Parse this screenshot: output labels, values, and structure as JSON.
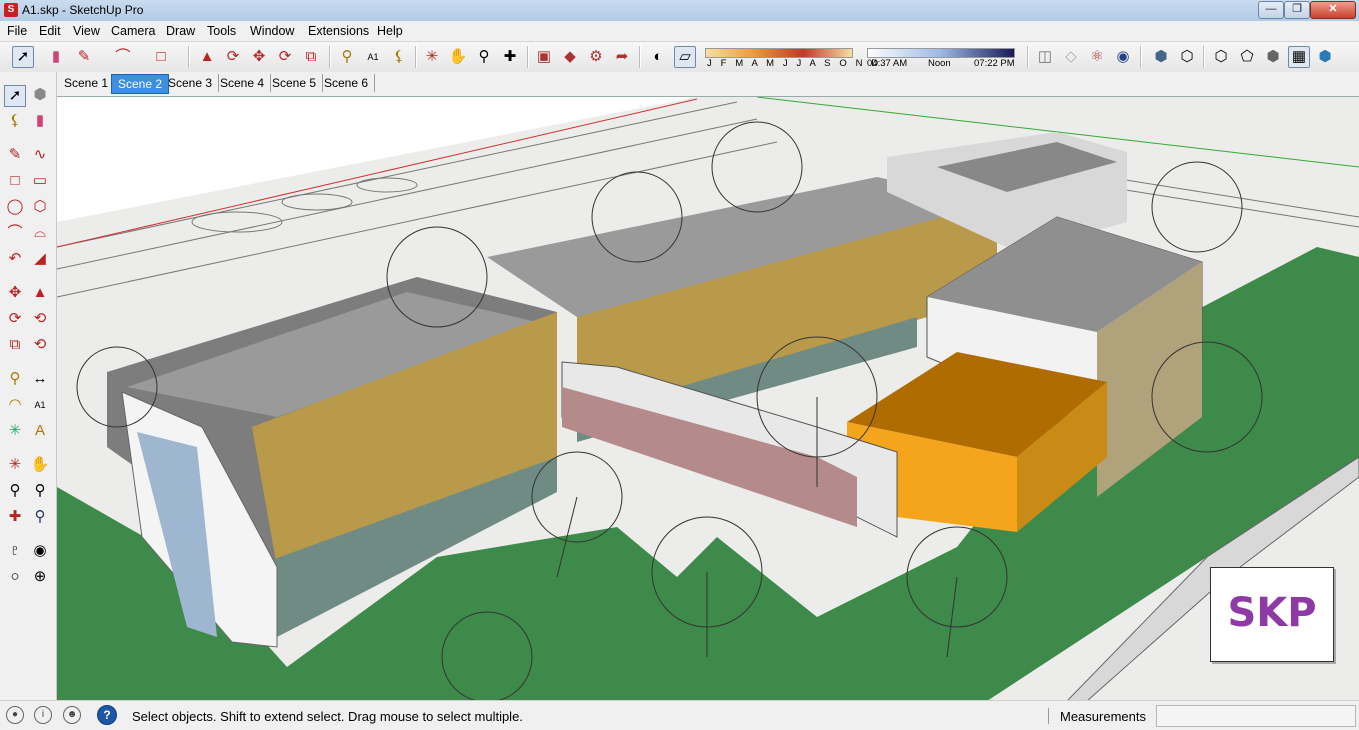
{
  "window": {
    "title": "A1.skp - SketchUp Pro",
    "app_icon": "sketchup-icon",
    "controls": [
      "minimize-icon",
      "maximize-icon",
      "close-icon"
    ]
  },
  "menu": [
    "File",
    "Edit",
    "View",
    "Camera",
    "Draw",
    "Tools",
    "Window",
    "Extensions",
    "Help"
  ],
  "toolbar": {
    "tools": [
      "select-icon",
      "eraser-icon",
      "pencil-icon",
      "arc-icon",
      "rectangle-icon",
      "push-pull-icon",
      "follow-me-icon",
      "move-icon",
      "rotate-icon",
      "scale-icon",
      "tape-measure-icon",
      "text-icon",
      "paint-bucket-icon",
      "orbit-icon",
      "pan-icon",
      "zoom-icon",
      "zoom-extents-icon",
      "warehouse-icon",
      "components-icon",
      "extensions-icon",
      "share-icon",
      "shadows-icon",
      "fog-icon"
    ],
    "shadow_months": "J F M A M J J A S O N D",
    "shadow_time_start": "04:37 AM",
    "shadow_time_mid": "Noon",
    "shadow_time_end": "07:22 PM",
    "right_tools": [
      "section-plane-icon",
      "section-display-icon",
      "axes-icon",
      "dimensions-icon",
      "iso-view-icon",
      "top-view-icon",
      "xray-icon",
      "wireframe-icon",
      "hidden-line-icon",
      "shaded-icon",
      "shaded-textures-icon",
      "monochrome-icon"
    ]
  },
  "scenes": {
    "tabs": [
      "Scene 1",
      "Scene 2",
      "Scene 3",
      "Scene 4",
      "Scene 5",
      "Scene 6"
    ],
    "active": "Scene 2"
  },
  "viewport": {
    "description_icon": "3d-model-viewport",
    "logo_text": "SKP",
    "colors": {
      "lawn": "#3e8a4a",
      "facade": "#b99a4a",
      "accent": "#f4a51c",
      "roof": "#8f8f8f",
      "glass": "#b48a8a"
    }
  },
  "status": {
    "icons": [
      "geolocation-icon",
      "credits-icon",
      "user-icon",
      "help-icon"
    ],
    "help_glyph": "?",
    "message": "Select objects. Shift to extend select. Drag mouse to select multiple.",
    "measurements_label": "Measurements",
    "measurements_value": ""
  }
}
